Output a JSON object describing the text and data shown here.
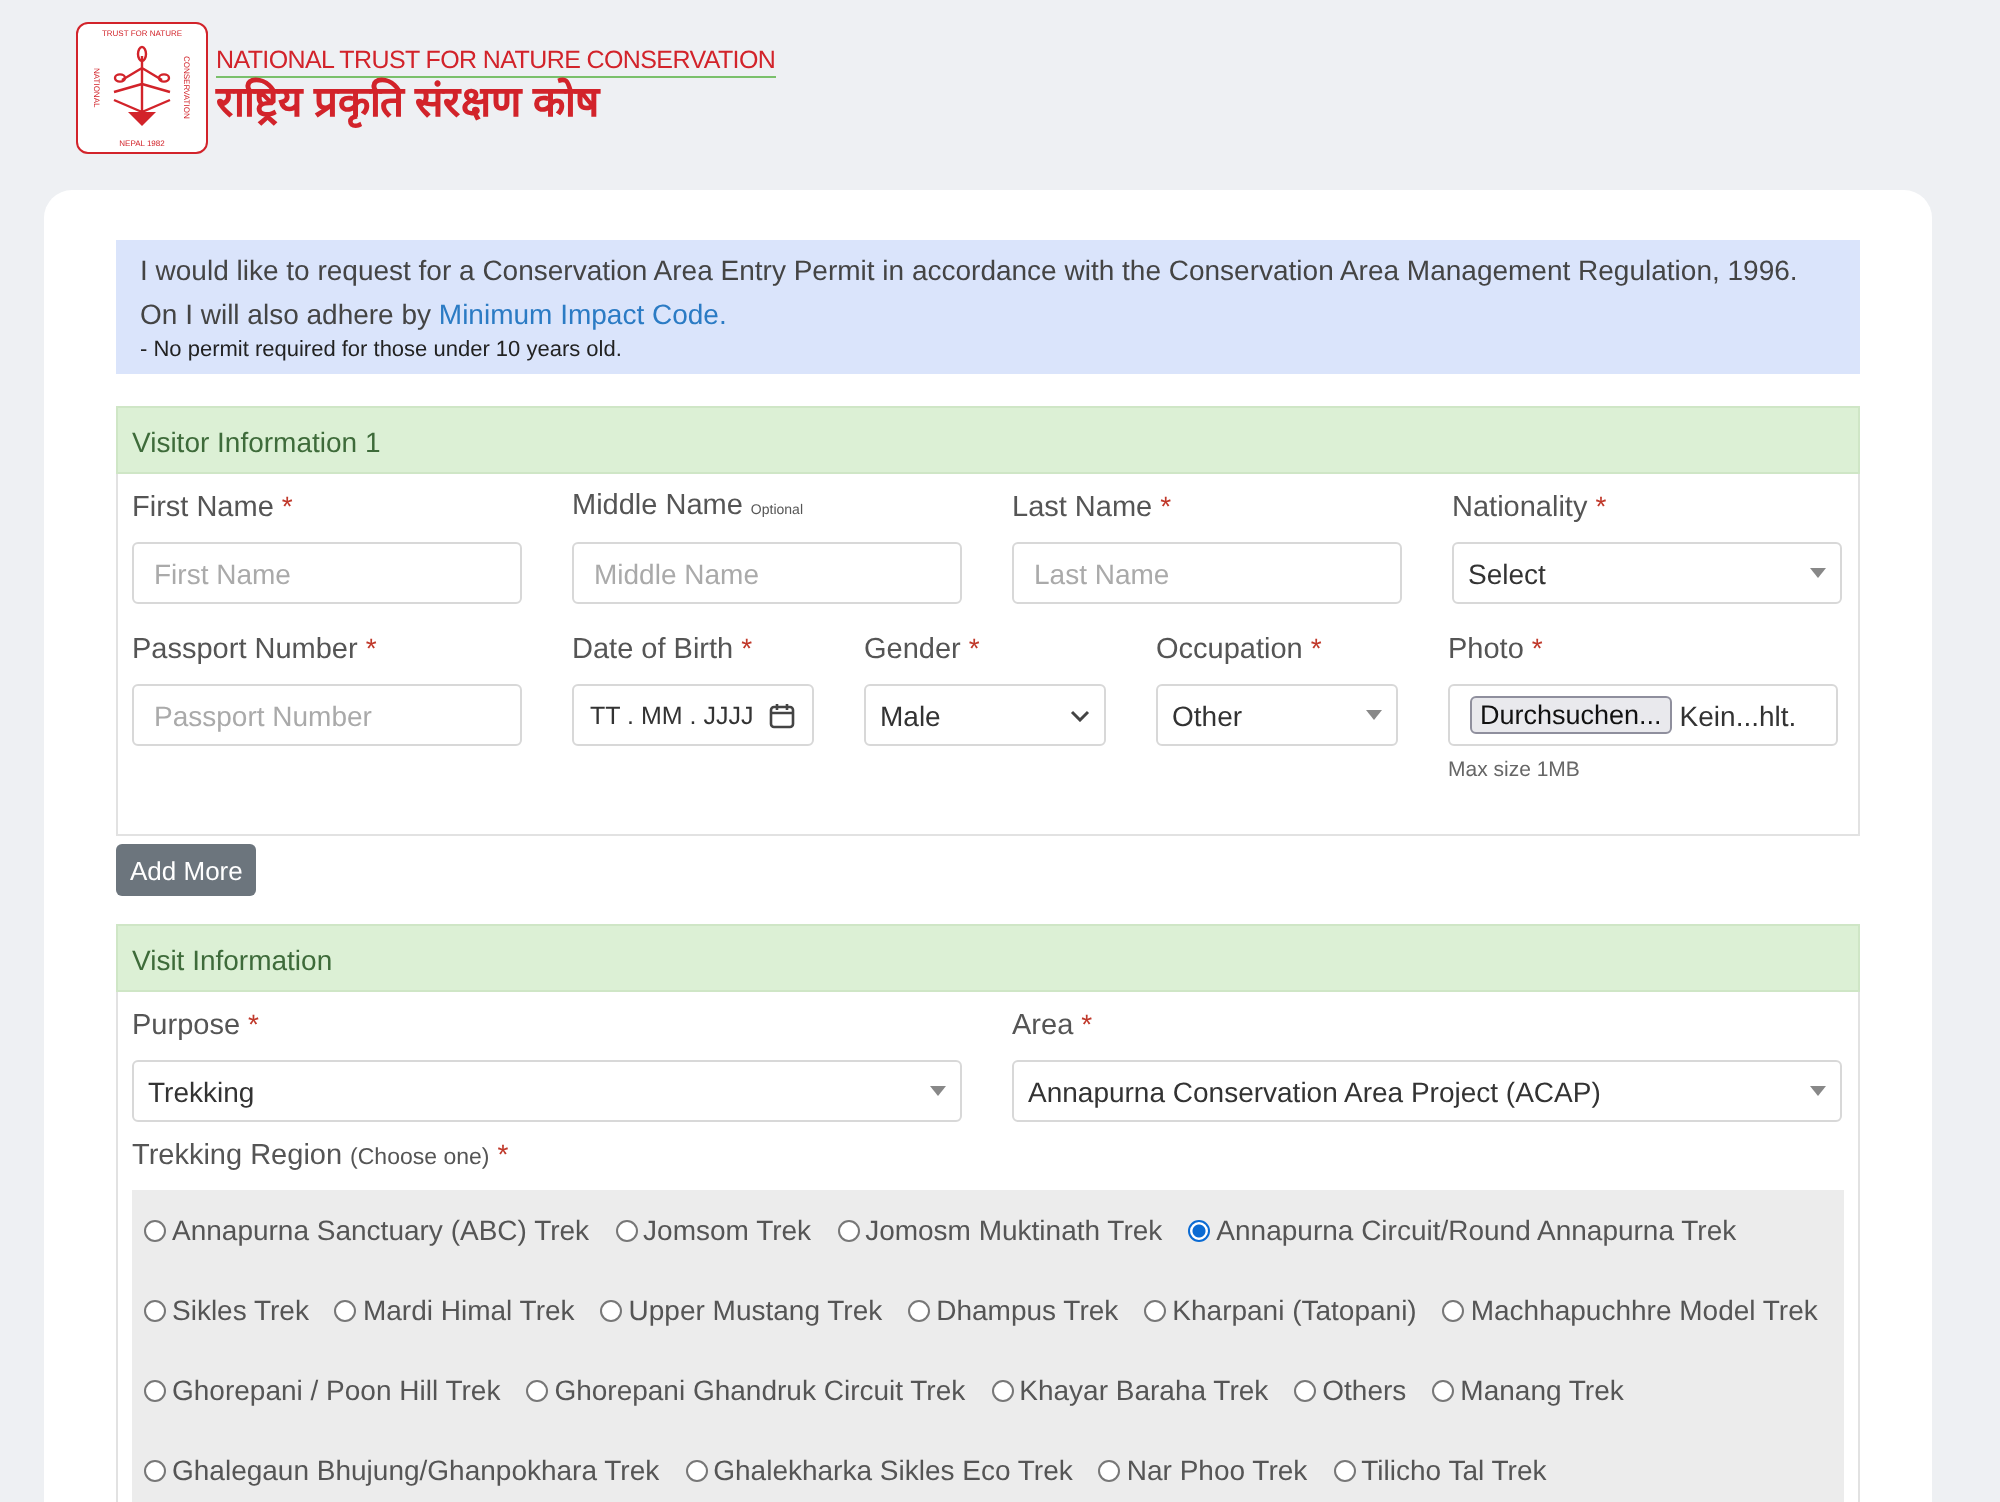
{
  "header": {
    "emblem_top": "TRUST FOR NATURE",
    "emblem_left": "NATIONAL",
    "emblem_right": "CONSERVATION",
    "emblem_bottom": "NEPAL 1982",
    "title_en": "NATIONAL TRUST FOR NATURE CONSERVATION",
    "title_ne": "राष्ट्रिय प्रकृति संरक्षण कोष"
  },
  "notice": {
    "text": "I would like to request for a Conservation Area Entry Permit in accordance with the Conservation Area Management Regulation, 1996. On I will also adhere by",
    "link": "Minimum Impact Code.",
    "note": "- No permit required for those under 10 years old."
  },
  "visitor_section": {
    "title": "Visitor Information 1",
    "rows": [
      {
        "fields": [
          {
            "label": "First Name",
            "mark": "*",
            "kind": "text",
            "placeholder": "First Name"
          },
          {
            "label": "Middle Name",
            "hint": "Optional",
            "kind": "text",
            "placeholder": "Middle Name"
          },
          {
            "label": "Last Name",
            "mark": "*",
            "kind": "text",
            "placeholder": "Last Name"
          },
          {
            "label": "Nationality",
            "mark": "*",
            "kind": "combo",
            "value": "Select"
          }
        ]
      },
      {
        "fields": [
          {
            "label": "Passport Number",
            "mark": "*",
            "kind": "text",
            "placeholder": "Passport Number"
          },
          {
            "label": "Date of Birth",
            "mark": "*",
            "kind": "date",
            "value": "TT . MM . JJJJ"
          },
          {
            "label": "Gender",
            "mark": "*",
            "kind": "select",
            "value": "Male"
          },
          {
            "label": "Occupation",
            "mark": "*",
            "kind": "combo",
            "value": "Other"
          },
          {
            "label": "Photo",
            "mark": "*",
            "kind": "file",
            "button": "Durchsuchen...",
            "value": "Kein...hlt.",
            "help": "Max size 1MB"
          }
        ]
      }
    ]
  },
  "add_more": "Add More",
  "visit_section": {
    "title": "Visit Information",
    "fields": [
      {
        "label": "Purpose",
        "mark": "*",
        "kind": "combo",
        "value": "Trekking"
      },
      {
        "label": "Area",
        "mark": "*",
        "kind": "combo",
        "value": "Annapurna Conservation Area Project (ACAP)"
      }
    ],
    "region": {
      "label": "Trekking Region",
      "hint": "(Choose one)",
      "mark": "*",
      "lines": [
        {
          "options": [
            {
              "label": "Annapurna Sanctuary (ABC) Trek",
              "selected": false
            },
            {
              "label": "Jomsom Trek",
              "selected": false
            },
            {
              "label": "Jomosm Muktinath Trek",
              "selected": false
            },
            {
              "label": "Annapurna Circuit/Round Annapurna Trek",
              "selected": true
            }
          ]
        },
        {
          "options": [
            {
              "label": "Sikles Trek",
              "selected": false
            },
            {
              "label": "Mardi Himal Trek",
              "selected": false
            },
            {
              "label": "Upper Mustang Trek",
              "selected": false
            },
            {
              "label": "Dhampus Trek",
              "selected": false
            },
            {
              "label": "Kharpani (Tatopani)",
              "selected": false
            },
            {
              "label": "Machhapuchhre Model Trek",
              "selected": false
            }
          ]
        },
        {
          "options": [
            {
              "label": "Ghorepani / Poon Hill Trek",
              "selected": false
            },
            {
              "label": "Ghorepani Ghandruk Circuit Trek",
              "selected": false
            },
            {
              "label": "Khayar Baraha Trek",
              "selected": false
            },
            {
              "label": "Others",
              "selected": false
            },
            {
              "label": "Manang Trek",
              "selected": false
            }
          ]
        },
        {
          "options": [
            {
              "label": "Ghalegaun Bhujung/Ghanpokhara Trek",
              "selected": false
            },
            {
              "label": "Ghalekharka Sikles Eco Trek",
              "selected": false
            },
            {
              "label": "Nar Phoo Trek",
              "selected": false
            },
            {
              "label": "Tilicho Tal Trek",
              "selected": false
            }
          ]
        }
      ]
    }
  }
}
